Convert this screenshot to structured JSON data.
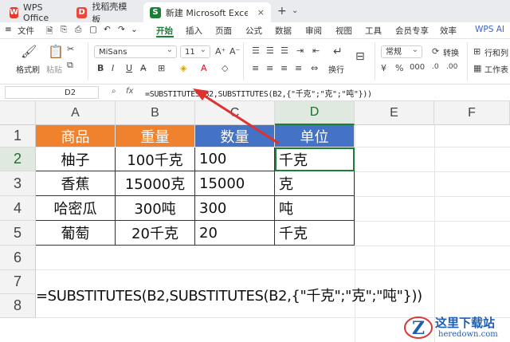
{
  "tabs": [
    {
      "label": "WPS Office",
      "icon": "wps-logo-icon"
    },
    {
      "label": "找稻壳模板",
      "icon": "docer-icon"
    },
    {
      "label": "新建 Microsoft Excel 工作表",
      "icon": "sheet-icon",
      "close": "×"
    }
  ],
  "tab_plus": "+",
  "menu": {
    "file": "文件",
    "items": [
      "开始",
      "插入",
      "页面",
      "公式",
      "数据",
      "审阅",
      "视图",
      "工具",
      "会员专享",
      "效率"
    ],
    "active": "开始",
    "wps_ai": "WPS AI"
  },
  "ribbon": {
    "format_painter": "格式刷",
    "paste": "粘贴",
    "font_name": "MiSans",
    "font_size": "11",
    "bold": "B",
    "italic": "I",
    "underline": "U",
    "wrap": "换行",
    "number_format": "常规",
    "convert": "转换",
    "rows_cols": "行和列",
    "worksheet": "工作表"
  },
  "formula_bar": {
    "cell_ref": "D2",
    "fx": "fx",
    "formula": "=SUBSTITUTES(B2,SUBSTITUTES(B2,{\"千克\";\"克\";\"吨\"}))"
  },
  "grid": {
    "columns": [
      "A",
      "B",
      "C",
      "D",
      "E",
      "F"
    ],
    "rows": [
      "1",
      "2",
      "3",
      "4",
      "5",
      "6",
      "7",
      "8"
    ],
    "headers": [
      "商品",
      "重量",
      "数量",
      "单位"
    ],
    "data": [
      [
        "柚子",
        "100千克",
        "100",
        "千克"
      ],
      [
        "香蕉",
        "15000克",
        "15000",
        "克"
      ],
      [
        "哈密瓜",
        "300吨",
        "300",
        "吨"
      ],
      [
        "葡萄",
        "20千克",
        "20",
        "千克"
      ]
    ],
    "header_colors": [
      "#f0822e",
      "#f0822e",
      "#4472c4",
      "#4472c4"
    ],
    "row7_formula": "=SUBSTITUTES(B2,SUBSTITUTES(B2,{\"千克\";\"克\";\"吨\"}))"
  },
  "watermark": {
    "title": "这里下载站",
    "url": "heredown.com"
  }
}
